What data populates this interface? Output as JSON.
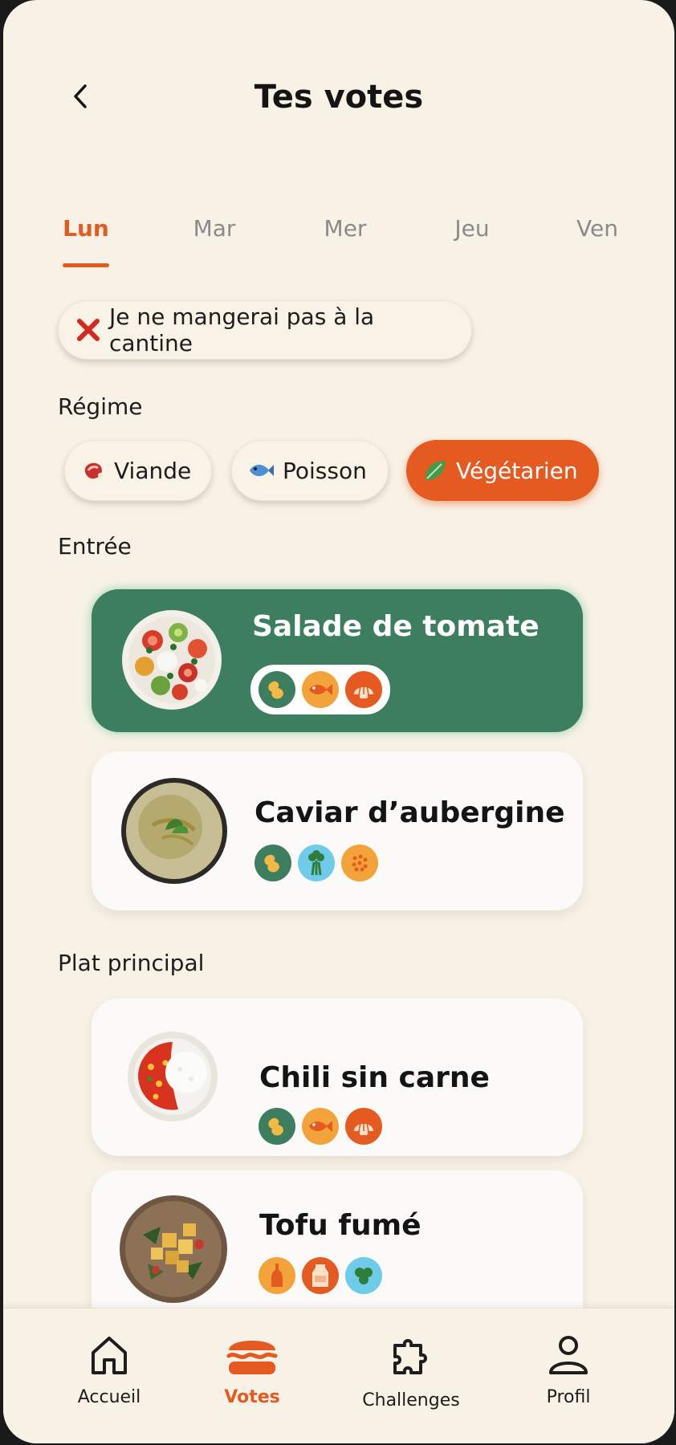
{
  "header": {
    "title": "Tes votes",
    "back_icon": "chevron-left-icon"
  },
  "days": [
    {
      "label": "Lun",
      "active": true
    },
    {
      "label": "Mar",
      "active": false
    },
    {
      "label": "Mer",
      "active": false
    },
    {
      "label": "Jeu",
      "active": false
    },
    {
      "label": "Ven",
      "active": false
    }
  ],
  "skip": {
    "label": "Je ne mangerai pas à la cantine",
    "icon": "red-cross-icon"
  },
  "regime": {
    "title": "Régime",
    "options": [
      {
        "label": "Viande",
        "icon": "meat-icon",
        "active": false
      },
      {
        "label": "Poisson",
        "icon": "fish-icon",
        "active": false
      },
      {
        "label": "Végétarien",
        "icon": "leaf-icon",
        "active": true
      }
    ]
  },
  "entree": {
    "title": "Entrée",
    "items": [
      {
        "name": "Salade de tomate",
        "selected": true,
        "badges": [
          "peanut-icon",
          "fish-icon",
          "shell-icon"
        ]
      },
      {
        "name": "Caviar d’aubergine",
        "selected": false,
        "badges": [
          "peanut-icon",
          "celery-icon",
          "sesame-icon"
        ]
      }
    ]
  },
  "plat": {
    "title": "Plat principal",
    "items": [
      {
        "name": "Chili sin carne",
        "selected": false,
        "badges": [
          "peanut-icon",
          "fish-icon",
          "shell-icon"
        ]
      },
      {
        "name": "Tofu fumé",
        "selected": false,
        "badges": [
          "bottle-icon",
          "milk-icon",
          "soy-icon"
        ]
      }
    ]
  },
  "nav": [
    {
      "label": "Accueil",
      "icon": "home-icon",
      "active": false
    },
    {
      "label": "Votes",
      "icon": "burger-icon",
      "active": true
    },
    {
      "label": "Challenges",
      "icon": "puzzle-icon",
      "active": false
    },
    {
      "label": "Profil",
      "icon": "user-icon",
      "active": false
    }
  ],
  "colors": {
    "accent": "#E45A21",
    "selected_card": "#3D7E61",
    "background": "#F8F2E6"
  }
}
